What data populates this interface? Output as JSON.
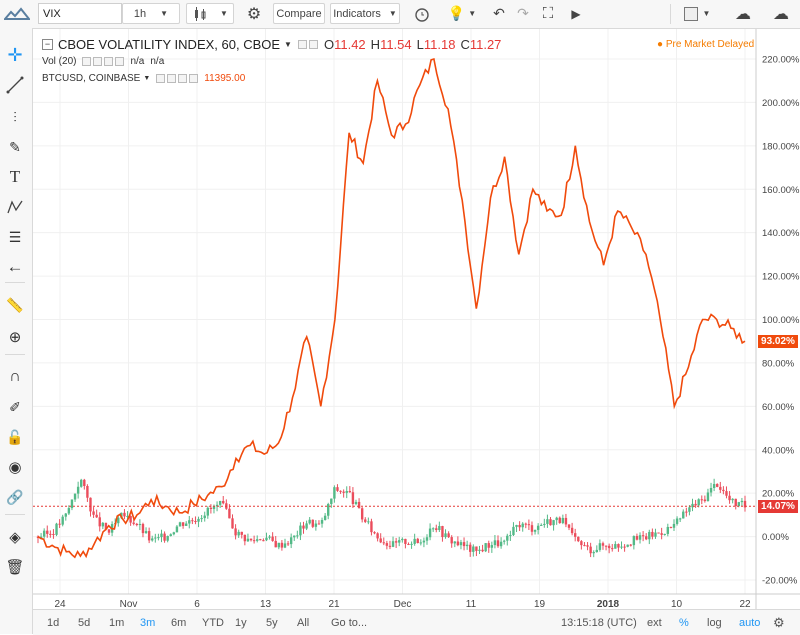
{
  "toolbar": {
    "symbol": "VIX",
    "interval": "1h",
    "compare_label": "Compare",
    "indicators_label": "Indicators"
  },
  "legend": {
    "main_title": "CBOE VOLATILITY INDEX, 60, CBOE",
    "o_label": "O",
    "o_value": "11.42",
    "h_label": "H",
    "h_value": "11.54",
    "l_label": "L",
    "l_value": "11.18",
    "c_label": "C",
    "c_value": "11.27",
    "vol_label": "Vol (20)",
    "vol_value1": "n/a",
    "vol_value2": "n/a",
    "btc_label": "BTCUSD, COINBASE",
    "btc_value": "11395.00",
    "pre_market": "Pre Market Delayed",
    "pre_market_dot": "●"
  },
  "price_tags": {
    "btc_pct": "93.02%",
    "vix_pct": "14.07%"
  },
  "bottombar": {
    "ranges": [
      "1d",
      "5d",
      "1m",
      "3m",
      "6m",
      "YTD",
      "1y",
      "5y",
      "All"
    ],
    "active_range": "3m",
    "goto_label": "Go to...",
    "time": "13:15:18 (UTC)",
    "ext": "ext",
    "pct": "%",
    "log": "log",
    "auto": "auto"
  },
  "colors": {
    "btc_line": "#f04a0c",
    "candle_up": "#53b987",
    "candle_down": "#eb4d5c",
    "accent_blue": "#2196f3",
    "tag_red": "#e53935"
  },
  "icons": {
    "sidebar": [
      "crosshair-icon",
      "trend-line-icon",
      "pitchfork-icon",
      "brush-icon",
      "text-icon",
      "pattern-icon",
      "gann-icon",
      "back-arrow-icon",
      "ruler-icon",
      "zoom-in-icon",
      "magnet-icon",
      "lock-draw-icon",
      "lock-icon",
      "eye-icon",
      "link-icon",
      "layers-icon",
      "trash-icon"
    ]
  },
  "chart_data": {
    "type": "line",
    "y_axis": {
      "ticks": [
        "220.00%",
        "200.00%",
        "180.00%",
        "160.00%",
        "140.00%",
        "120.00%",
        "100.00%",
        "80.00%",
        "60.00%",
        "40.00%",
        "20.00%",
        "0.00%",
        "-20.00%"
      ],
      "values": [
        220,
        200,
        180,
        160,
        140,
        120,
        100,
        80,
        60,
        40,
        20,
        0,
        -20
      ],
      "ylim": [
        -20,
        220
      ]
    },
    "x_axis": {
      "ticks": [
        "24",
        "Nov",
        "6",
        "13",
        "21",
        "Dec",
        "11",
        "19",
        "2018",
        "10",
        "22"
      ],
      "bold": [
        "2018"
      ]
    },
    "series": [
      {
        "name": "BTCUSD",
        "x": [
          0,
          2,
          4,
          6,
          8,
          10,
          12,
          14,
          16,
          18,
          20,
          22,
          24,
          26,
          28,
          30,
          32,
          34,
          36,
          38,
          40,
          42,
          44,
          46,
          48,
          50,
          52,
          54,
          56,
          58,
          60,
          62,
          64,
          66,
          68,
          70,
          72,
          74,
          76,
          78,
          80,
          82,
          84,
          86,
          88,
          90,
          92,
          94,
          96,
          98,
          100
        ],
        "values": [
          0,
          -4,
          -7,
          -9,
          -3,
          5,
          8,
          10,
          17,
          14,
          11,
          15,
          19,
          23,
          36,
          42,
          38,
          43,
          64,
          92,
          60,
          100,
          186,
          172,
          210,
          185,
          190,
          208,
          220,
          197,
          155,
          105,
          156,
          175,
          130,
          160,
          150,
          148,
          180,
          145,
          125,
          150,
          142,
          130,
          100,
          60,
          78,
          100,
          100,
          96,
          90
        ]
      },
      {
        "name": "CBOE VOLATILITY INDEX (percent change)",
        "x": [
          0,
          2,
          4,
          6,
          8,
          10,
          12,
          14,
          16,
          18,
          20,
          22,
          24,
          26,
          28,
          30,
          32,
          34,
          36,
          38,
          40,
          42,
          44,
          46,
          48,
          50,
          52,
          54,
          56,
          58,
          60,
          62,
          64,
          66,
          68,
          70,
          72,
          74,
          76,
          78,
          80,
          82,
          84,
          86,
          88,
          90,
          92,
          94,
          96,
          98,
          100
        ],
        "values": [
          0,
          2,
          10,
          27,
          8,
          2,
          10,
          6,
          -2,
          0,
          6,
          8,
          12,
          15,
          2,
          -2,
          0,
          -4,
          -1,
          7,
          5,
          22,
          20,
          8,
          0,
          -4,
          -2,
          -3,
          6,
          -1,
          -4,
          -7,
          -3,
          -3,
          6,
          4,
          7,
          8,
          -2,
          -6,
          -4,
          -4,
          -2,
          0,
          2,
          5,
          13,
          17,
          25,
          16,
          14
        ],
        "style": "candlestick"
      }
    ]
  }
}
